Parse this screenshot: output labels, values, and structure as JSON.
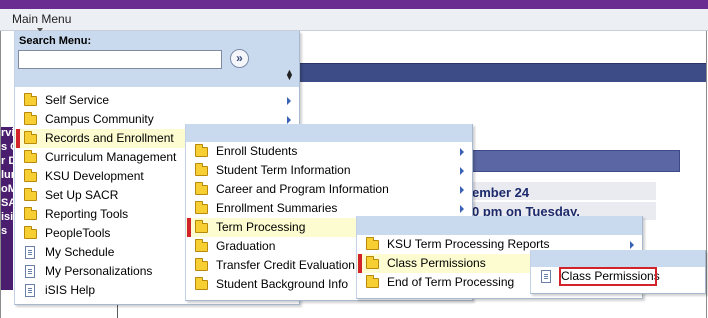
{
  "menu_bar": {
    "title": "Main Menu"
  },
  "search": {
    "label": "Search Menu:",
    "value": "",
    "placeholder": ""
  },
  "background": {
    "purple_fragments": [
      "rvi",
      "s C",
      "r D",
      "lun",
      "oM",
      "SA",
      "isit",
      "s"
    ],
    "lines": [
      "ember 24",
      "0 pm on Tuesday,"
    ]
  },
  "level1": [
    {
      "label": "Self Service",
      "icon": "folder-icon",
      "submenu": true
    },
    {
      "label": "Campus Community",
      "icon": "folder-icon",
      "submenu": true
    },
    {
      "label": "Records and Enrollment",
      "icon": "folder-icon",
      "submenu": true,
      "selected": true
    },
    {
      "label": "Curriculum Management",
      "icon": "folder-icon",
      "submenu": true
    },
    {
      "label": "KSU Development",
      "icon": "folder-icon",
      "submenu": true
    },
    {
      "label": "Set Up SACR",
      "icon": "folder-icon",
      "submenu": true
    },
    {
      "label": "Reporting Tools",
      "icon": "folder-icon",
      "submenu": true
    },
    {
      "label": "PeopleTools",
      "icon": "folder-icon",
      "submenu": true
    },
    {
      "label": "My Schedule",
      "icon": "document-icon",
      "submenu": false
    },
    {
      "label": "My Personalizations",
      "icon": "document-icon",
      "submenu": false
    },
    {
      "label": "iSIS Help",
      "icon": "document-icon",
      "submenu": false
    }
  ],
  "level2": [
    {
      "label": "Enroll Students",
      "icon": "folder-icon",
      "submenu": true
    },
    {
      "label": "Student Term Information",
      "icon": "folder-icon",
      "submenu": true
    },
    {
      "label": "Career and Program Information",
      "icon": "folder-icon",
      "submenu": true
    },
    {
      "label": "Enrollment Summaries",
      "icon": "folder-icon",
      "submenu": true
    },
    {
      "label": "Term Processing",
      "icon": "folder-icon",
      "submenu": true,
      "selected": true
    },
    {
      "label": "Graduation",
      "icon": "folder-icon",
      "submenu": true
    },
    {
      "label": "Transfer Credit Evaluation",
      "icon": "folder-icon",
      "submenu": true
    },
    {
      "label": "Student Background Info",
      "icon": "folder-icon",
      "submenu": true
    }
  ],
  "level3": [
    {
      "label": "KSU Term Processing Reports",
      "icon": "folder-icon",
      "submenu": true
    },
    {
      "label": "Class Permissions",
      "icon": "folder-icon",
      "submenu": true,
      "selected": true
    },
    {
      "label": "End of Term Processing",
      "icon": "folder-icon",
      "submenu": true
    }
  ],
  "level4": [
    {
      "label": "Class Permissions",
      "icon": "document-icon",
      "submenu": false,
      "selected": true
    }
  ]
}
